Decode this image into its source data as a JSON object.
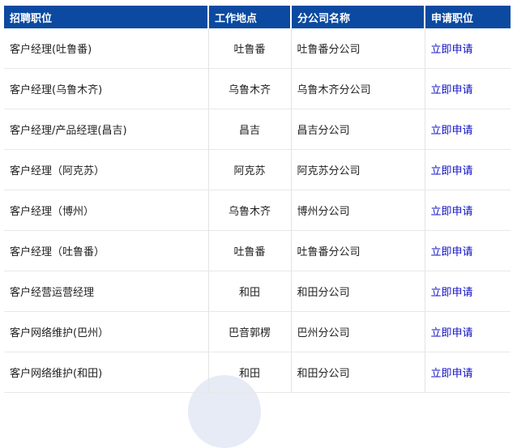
{
  "table": {
    "headers": [
      "招聘职位",
      "工作地点",
      "分公司名称",
      "申请职位"
    ],
    "rows": [
      {
        "position": "客户经理(吐鲁番)",
        "location": "吐鲁番",
        "branch": "吐鲁番分公司",
        "action": "立即申请"
      },
      {
        "position": "客户经理(乌鲁木齐)",
        "location": "乌鲁木齐",
        "branch": "乌鲁木齐分公司",
        "action": "立即申请"
      },
      {
        "position": "客户经理/产品经理(昌吉)",
        "location": "昌吉",
        "branch": "昌吉分公司",
        "action": "立即申请"
      },
      {
        "position": "客户经理（阿克苏）",
        "location": "阿克苏",
        "branch": "阿克苏分公司",
        "action": "立即申请"
      },
      {
        "position": "客户经理（博州）",
        "location": "乌鲁木齐",
        "branch": "博州分公司",
        "action": "立即申请"
      },
      {
        "position": "客户经理（吐鲁番）",
        "location": "吐鲁番",
        "branch": "吐鲁番分公司",
        "action": "立即申请"
      },
      {
        "position": "客户经营运营经理",
        "location": "和田",
        "branch": "和田分公司",
        "action": "立即申请"
      },
      {
        "position": "客户网络维护(巴州）",
        "location": "巴音郭楞",
        "branch": "巴州分公司",
        "action": "立即申请"
      },
      {
        "position": "客户网络维护(和田)",
        "location": "和田",
        "branch": "和田分公司",
        "action": "立即申请"
      }
    ]
  },
  "colors": {
    "header_bg": "#0b4aa0",
    "link": "#1010c8"
  }
}
